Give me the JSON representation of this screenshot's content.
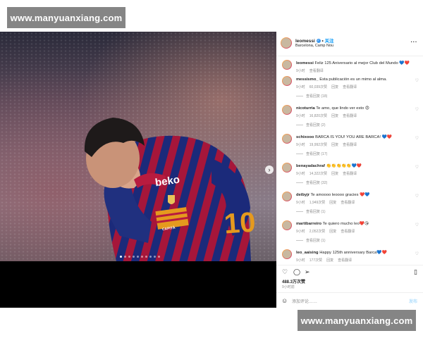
{
  "watermark": {
    "text": "www.manyuanxiang.com"
  },
  "post": {
    "username": "leomessi",
    "follow_label": "关注",
    "location": "Barcelona, Camp Nou",
    "more_label": "···",
    "caption": {
      "username": "leomessi",
      "text": "Feliz 125 Aniversario al mejor Club del Mundo 💙❤️",
      "time": "9小时",
      "translate": "查看翻译"
    },
    "likes": "488.3万次赞",
    "time_ago": "9小时前",
    "add_comment_placeholder": "添加评论……",
    "post_label": "发布"
  },
  "comments": [
    {
      "user": "messismo_",
      "text": "Esta publicación es un mimo al alma.",
      "time": "9小时",
      "likes": "60,039次赞",
      "reply": "回复",
      "translate": "查看翻译",
      "replies": "查看回复 (18)"
    },
    {
      "user": "nicoturria",
      "text": "Te amo, que lindo ver esto 😍",
      "time": "9小时",
      "likes": "16,820次赞",
      "reply": "回复",
      "translate": "查看翻译",
      "replies": "查看回复 (2)"
    },
    {
      "user": "schixooo",
      "text": "BARCA IS YOU! YOU ARE BARCA! 💙❤️",
      "time": "9小时",
      "likes": "19,992次赞",
      "reply": "回复",
      "translate": "查看翻译",
      "replies": "查看回复 (17)"
    },
    {
      "user": "benayadachraf",
      "text": "👏👏👏👏👏💙❤️",
      "time": "9小时",
      "likes": "14,322次赞",
      "reply": "回复",
      "translate": "查看翻译",
      "replies": "查看回复 (32)"
    },
    {
      "user": "deibyjr",
      "text": "Te amoooo leoooo gracies ❤️💙",
      "time": "9小时",
      "likes": "1,949次赞",
      "reply": "回复",
      "translate": "查看翻译",
      "replies": "查看回复 (1)"
    },
    {
      "user": "martibarreiro",
      "text": "Te quiero mucho leo❤️😘",
      "time": "9小时",
      "likes": "2,052次赞",
      "reply": "回复",
      "translate": "查看翻译",
      "replies": "查看回复 (1)"
    },
    {
      "user": "leo_aaising",
      "text": "Happy 125th anniversary Barca💙❤️",
      "time": "9小时",
      "likes": "177次赞",
      "reply": "回复",
      "translate": "查看翻译",
      "replies": ""
    }
  ],
  "photo": {
    "sponsor": "beko",
    "number": "10",
    "armband": "CAPITÀ"
  },
  "icons": {
    "heart": "heart-icon",
    "comment": "comment-icon",
    "share": "share-icon",
    "save": "bookmark-icon",
    "emoji": "emoji-icon",
    "next": "chevron-right-icon",
    "more": "more-icon",
    "verified": "verified-badge-icon"
  },
  "colors": {
    "accent": "#0095f6",
    "verified": "#3897f0",
    "jersey_blue": "#1b2a7a",
    "jersey_red": "#a6163a"
  }
}
